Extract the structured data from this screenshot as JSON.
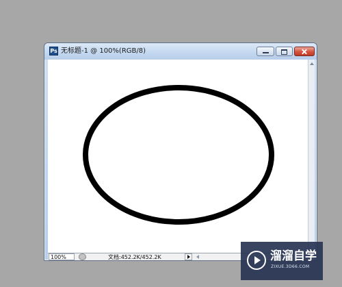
{
  "window": {
    "app_icon_text": "Ps",
    "title": "无标题-1 @ 100%(RGB/8)"
  },
  "status_bar": {
    "zoom": "100%",
    "doc_info": "文档:452.2K/452.2K"
  },
  "watermark": {
    "title": "溜溜自学",
    "subtitle": "ZIXUE.3D66.COM"
  },
  "canvas": {
    "shape": "ellipse",
    "stroke_color": "#000000",
    "fill_color": "#ffffff"
  },
  "colors": {
    "desktop_background": "#a7a7a7",
    "close_button": "#c03a25",
    "watermark_background": "#273453"
  },
  "icons": [
    "app-icon",
    "minimize-icon",
    "maximize-icon",
    "close-icon",
    "status-menu-arrow-icon",
    "play-logo-icon"
  ]
}
